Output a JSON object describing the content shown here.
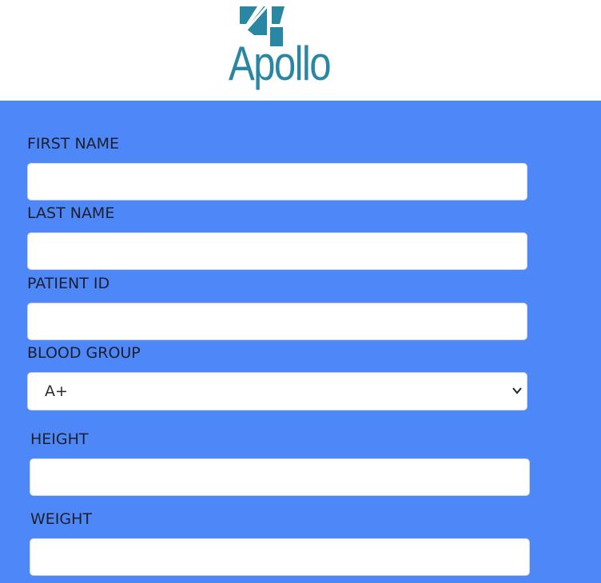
{
  "brand": {
    "name": "Apollo",
    "color": "#2a87a3"
  },
  "form": {
    "background": "#4e88f8",
    "first_name": {
      "label": "FIRST NAME",
      "value": ""
    },
    "last_name": {
      "label": "LAST NAME",
      "value": ""
    },
    "patient_id": {
      "label": "PATIENT ID",
      "value": ""
    },
    "blood_group": {
      "label": "BLOOD GROUP",
      "selected": "A+"
    },
    "height": {
      "label": "HEIGHT",
      "value": ""
    },
    "weight": {
      "label": "WEIGHT",
      "value": ""
    }
  }
}
